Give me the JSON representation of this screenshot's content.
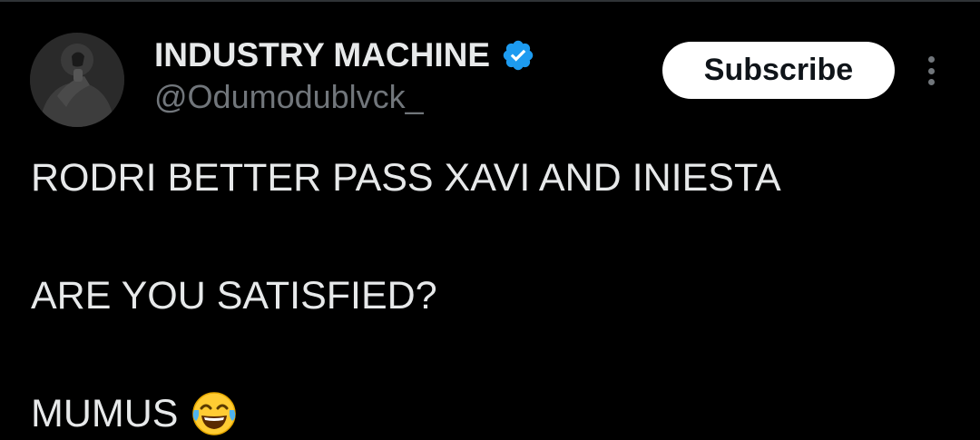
{
  "tweet": {
    "author": {
      "display_name": "INDUSTRY MACHINE",
      "handle": "@Odumodublvck_",
      "verified": true,
      "verified_icon": "verified-badge-icon",
      "avatar": "profile-avatar"
    },
    "subscribe_label": "Subscribe",
    "more_icon": "more-vertical-icon",
    "text_lines": [
      "RODRI BETTER PASS XAVI AND INIESTA",
      "ARE YOU SATISFIED?",
      "MUMUS"
    ],
    "emoji": "face-with-tears-of-joy-icon"
  },
  "colors": {
    "background": "#000000",
    "text_primary": "#e7e9ea",
    "text_secondary": "#71767b",
    "verified_blue": "#1d9bf0",
    "button_bg": "#ffffff"
  }
}
